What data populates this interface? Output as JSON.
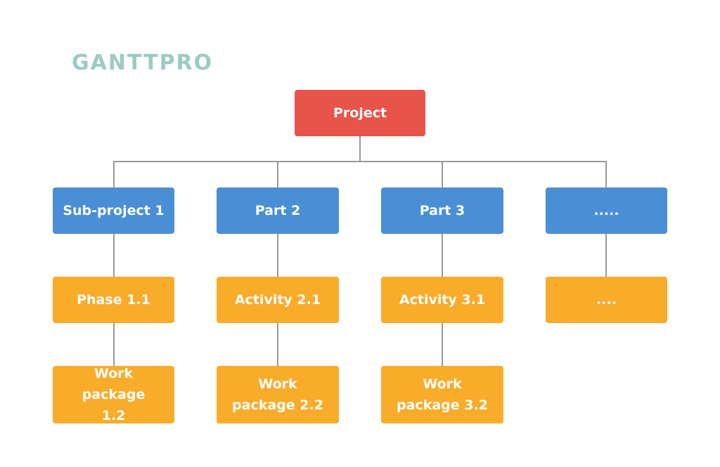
{
  "logo": {
    "text": "GANTTPRO"
  },
  "colors": {
    "root": "#e8534a",
    "level1": "#4a8fd6",
    "level2": "#f9ab2a",
    "connector": "#999999",
    "logo": "#9ccbc4"
  },
  "root": {
    "label": "Project"
  },
  "level1": [
    {
      "label": "Sub-project 1"
    },
    {
      "label": "Part 2"
    },
    {
      "label": "Part 3"
    },
    {
      "label": "....."
    }
  ],
  "level2": [
    {
      "label": "Phase 1.1"
    },
    {
      "label": "Activity 2.1"
    },
    {
      "label": "Activity 3.1"
    },
    {
      "label": "...."
    }
  ],
  "level3": [
    {
      "label": "Work package 1.2"
    },
    {
      "label": "Work package 2.2"
    },
    {
      "label": "Work package 3.2"
    }
  ]
}
